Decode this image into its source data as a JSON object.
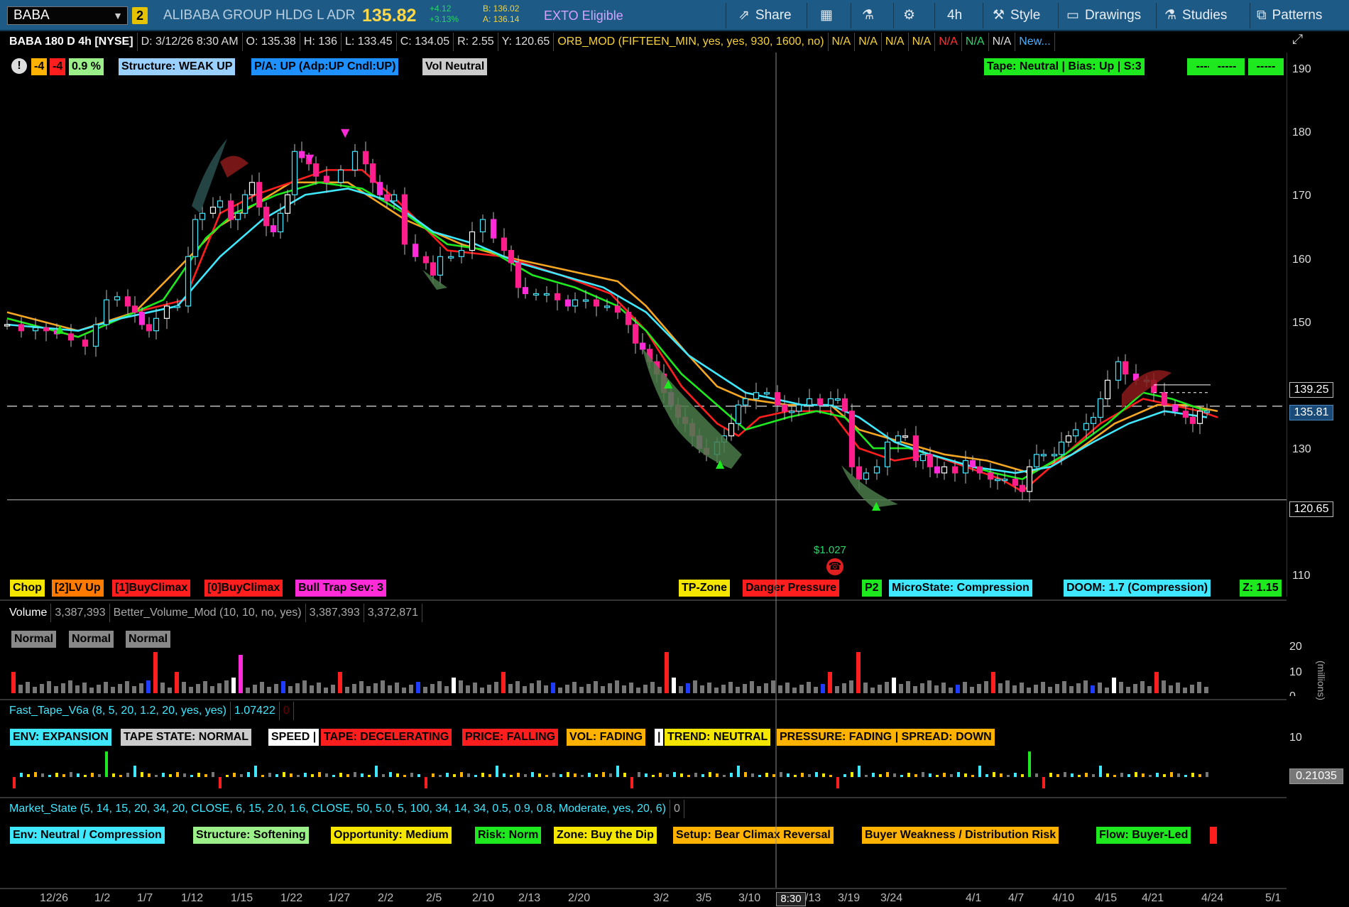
{
  "toolbar": {
    "symbol": "BABA",
    "link_badge": "2",
    "company": "ALIBABA GROUP HLDG L ADR",
    "last_price": "135.82",
    "change": "+4.12",
    "change_pct": "+3.13%",
    "bid": "B: 136.02",
    "ask": "A: 136.14",
    "exto": "EXTO Eligible",
    "share": "Share",
    "timeframe": "4h",
    "style": "Style",
    "drawings": "Drawings",
    "studies": "Studies",
    "patterns": "Patterns"
  },
  "header": {
    "title": "BABA 180 D 4h [NYSE]",
    "date": "D: 3/12/26 8:30 AM",
    "open": "O: 135.38",
    "high": "H: 136",
    "low": "L: 133.45",
    "close": "C: 134.05",
    "range": "R: 2.55",
    "y": "Y: 120.65",
    "study": "ORB_MOD (FIFTEEN_MIN, yes, yes, 930, 1600, no)",
    "na": [
      "N/A",
      "N/A",
      "N/A",
      "N/A",
      "N/A",
      "N/A",
      "N/A"
    ],
    "new": "New..."
  },
  "top_labels": {
    "alert": "!",
    "a": "-4",
    "b": "-4",
    "c": "0.9 %",
    "structure": "Structure: WEAK UP",
    "pa": "P/A: UP  (Adp:UP  Cndl:UP)",
    "vol": "Vol Neutral",
    "tape": "Tape: Neutral | Bias: Up | S:3",
    "d1": "-----",
    "d2": "-----",
    "d3": "-----"
  },
  "bottom_labels": {
    "chop": "Chop",
    "lv": "[2]LV Up",
    "bc1": "[1]BuyClimax",
    "bc0": "[0]BuyClimax",
    "trap": "Bull Trap  Sev: 3",
    "tp": "TP-Zone",
    "danger": "Danger Pressure",
    "p2": "P2",
    "micro": "MicroState: Compression",
    "doom": "DOOM: 1.7 (Compression)",
    "z": "Z: 1.15"
  },
  "annotation": "$1.027",
  "price_boxes": {
    "high_line": "139.25",
    "last": "135.81",
    "low_line": "120.65"
  },
  "volume_pane": {
    "label": "Volume",
    "value": "3,387,393",
    "study": "Better_Volume_Mod (10, 10, no, yes)",
    "v1": "3,387,393",
    "v2": "3,372,871",
    "tags": [
      "Normal",
      "Normal",
      "Normal"
    ],
    "axis": [
      "20",
      "10",
      "0"
    ],
    "unit": "(millions)"
  },
  "tape_pane": {
    "label": "Fast_Tape_V6a (8, 5, 20, 1.2, 20, yes, yes)",
    "value": "1.07422",
    "value2": "0",
    "env": "ENV: EXPANSION",
    "state": "TAPE STATE: NORMAL",
    "speed": "SPEED |",
    "tape": "TAPE: DECELERATING",
    "price": "PRICE: FALLING",
    "vol": "VOL: FADING",
    "bar": "|",
    "trend": "TREND: NEUTRAL",
    "pressure": "PRESSURE: FADING | SPREAD: DOWN",
    "axis": "10",
    "readout": "0.21035"
  },
  "market_pane": {
    "label": "Market_State (5, 14, 15, 20, 34, 20, CLOSE, 6, 15, 2.0, 1.6, CLOSE, 50, 5.0, 5, 100, 34, 14, 34, 0.5, 0.9, 0.8, Moderate, yes, 20, 6)",
    "value": "0",
    "env": "Env: Neutral / Compression",
    "structure": "Structure: Softening",
    "opp": "Opportunity: Medium",
    "risk": "Risk: Norm",
    "zone": "Zone: Buy the Dip",
    "setup": "Setup: Bear Climax Reversal",
    "buyer": "Buyer Weakness / Distribution Risk",
    "flow": "Flow: Buyer-Led"
  },
  "cursor_label": "8:30",
  "chart_data": {
    "type": "candlestick",
    "x_ticks": [
      "12/26",
      "1/2",
      "1/7",
      "1/12",
      "1/15",
      "1/22",
      "1/27",
      "2/2",
      "2/5",
      "2/10",
      "2/13",
      "2/20",
      "3/2",
      "3/5",
      "3/10",
      "3/13",
      "3/19",
      "3/24",
      "4/1",
      "4/7",
      "4/10",
      "4/15",
      "4/21",
      "4/24",
      "5/1"
    ],
    "y_ticks": [
      190,
      180,
      170,
      160,
      150,
      130,
      110
    ],
    "ylim": [
      105,
      193
    ],
    "price_path": [
      [
        0,
        149
      ],
      [
        20,
        148
      ],
      [
        40,
        148.5
      ],
      [
        55,
        148
      ],
      [
        70,
        147.5
      ],
      [
        90,
        146.5
      ],
      [
        110,
        145.5
      ],
      [
        125,
        149
      ],
      [
        140,
        153
      ],
      [
        155,
        153.5
      ],
      [
        170,
        152
      ],
      [
        180,
        151
      ],
      [
        190,
        149
      ],
      [
        200,
        148
      ],
      [
        210,
        150
      ],
      [
        225,
        152
      ],
      [
        240,
        152
      ],
      [
        255,
        160
      ],
      [
        265,
        166
      ],
      [
        275,
        167
      ],
      [
        290,
        168
      ],
      [
        300,
        169
      ],
      [
        315,
        166
      ],
      [
        325,
        167
      ],
      [
        335,
        170
      ],
      [
        345,
        172
      ],
      [
        355,
        168
      ],
      [
        365,
        165
      ],
      [
        375,
        164
      ],
      [
        385,
        167
      ],
      [
        395,
        170
      ],
      [
        405,
        177
      ],
      [
        415,
        176
      ],
      [
        425,
        175
      ],
      [
        435,
        173
      ],
      [
        450,
        172
      ],
      [
        470,
        174
      ],
      [
        490,
        177
      ],
      [
        505,
        175
      ],
      [
        515,
        172
      ],
      [
        525,
        170
      ],
      [
        535,
        169
      ],
      [
        545,
        170
      ],
      [
        560,
        162
      ],
      [
        575,
        160
      ],
      [
        590,
        159
      ],
      [
        600,
        157
      ],
      [
        610,
        160
      ],
      [
        625,
        160
      ],
      [
        640,
        161
      ],
      [
        655,
        164
      ],
      [
        670,
        166
      ],
      [
        685,
        163
      ],
      [
        700,
        161
      ],
      [
        710,
        159
      ],
      [
        720,
        155
      ],
      [
        730,
        154
      ],
      [
        745,
        154
      ],
      [
        760,
        154
      ],
      [
        775,
        153
      ],
      [
        790,
        152
      ],
      [
        800,
        153
      ],
      [
        815,
        153
      ],
      [
        830,
        152
      ],
      [
        845,
        152
      ],
      [
        860,
        151
      ],
      [
        875,
        149
      ],
      [
        885,
        146
      ],
      [
        895,
        145
      ],
      [
        905,
        143
      ],
      [
        915,
        141
      ],
      [
        925,
        138
      ],
      [
        935,
        136
      ],
      [
        945,
        134
      ],
      [
        955,
        133
      ],
      [
        965,
        131
      ],
      [
        975,
        129
      ],
      [
        985,
        128
      ],
      [
        1000,
        130
      ],
      [
        1010,
        131
      ],
      [
        1020,
        133
      ],
      [
        1030,
        136
      ],
      [
        1040,
        137
      ],
      [
        1055,
        138
      ],
      [
        1070,
        138
      ],
      [
        1085,
        136
      ],
      [
        1095,
        135
      ],
      [
        1105,
        135
      ],
      [
        1115,
        136
      ],
      [
        1130,
        137
      ],
      [
        1145,
        136
      ],
      [
        1160,
        137
      ],
      [
        1170,
        137
      ],
      [
        1180,
        135
      ],
      [
        1190,
        126
      ],
      [
        1200,
        124
      ],
      [
        1210,
        125
      ],
      [
        1225,
        126
      ],
      [
        1240,
        130
      ],
      [
        1255,
        131
      ],
      [
        1265,
        131
      ],
      [
        1280,
        127
      ],
      [
        1290,
        128
      ],
      [
        1300,
        126
      ],
      [
        1310,
        125
      ],
      [
        1320,
        126
      ],
      [
        1335,
        125
      ],
      [
        1350,
        127
      ],
      [
        1360,
        126
      ],
      [
        1370,
        125
      ],
      [
        1385,
        124
      ],
      [
        1395,
        124
      ],
      [
        1405,
        124
      ],
      [
        1420,
        123
      ],
      [
        1430,
        122
      ],
      [
        1440,
        126
      ],
      [
        1450,
        128
      ],
      [
        1460,
        128
      ],
      [
        1475,
        128
      ],
      [
        1485,
        130
      ],
      [
        1495,
        131
      ],
      [
        1505,
        132
      ],
      [
        1520,
        133
      ],
      [
        1530,
        134
      ],
      [
        1540,
        137
      ],
      [
        1550,
        140
      ],
      [
        1565,
        143
      ],
      [
        1575,
        141
      ],
      [
        1590,
        140
      ],
      [
        1605,
        140
      ],
      [
        1615,
        138
      ],
      [
        1630,
        136
      ],
      [
        1645,
        135
      ],
      [
        1660,
        134
      ],
      [
        1670,
        133
      ],
      [
        1680,
        135
      ],
      [
        1690,
        135
      ]
    ],
    "ema_red": [
      [
        0,
        150
      ],
      [
        100,
        147
      ],
      [
        180,
        151
      ],
      [
        250,
        153
      ],
      [
        300,
        167
      ],
      [
        350,
        170
      ],
      [
        400,
        172
      ],
      [
        450,
        174
      ],
      [
        500,
        174
      ],
      [
        550,
        169
      ],
      [
        620,
        161
      ],
      [
        700,
        160
      ],
      [
        780,
        157
      ],
      [
        850,
        154
      ],
      [
        900,
        148
      ],
      [
        950,
        139
      ],
      [
        1000,
        133
      ],
      [
        1030,
        131
      ],
      [
        1060,
        134
      ],
      [
        1100,
        135
      ],
      [
        1160,
        135
      ],
      [
        1200,
        129
      ],
      [
        1250,
        127
      ],
      [
        1300,
        128
      ],
      [
        1350,
        126
      ],
      [
        1400,
        124
      ],
      [
        1430,
        122
      ],
      [
        1480,
        127
      ],
      [
        1540,
        133
      ],
      [
        1600,
        137
      ],
      [
        1640,
        136
      ],
      [
        1680,
        135
      ],
      [
        1705,
        134
      ]
    ],
    "ema_yellow": [
      [
        0,
        151
      ],
      [
        100,
        148
      ],
      [
        180,
        151
      ],
      [
        300,
        165
      ],
      [
        400,
        172
      ],
      [
        480,
        172
      ],
      [
        560,
        166
      ],
      [
        640,
        162
      ],
      [
        700,
        160
      ],
      [
        780,
        158
      ],
      [
        860,
        156
      ],
      [
        900,
        152
      ],
      [
        960,
        144
      ],
      [
        1000,
        139
      ],
      [
        1040,
        137
      ],
      [
        1100,
        136
      ],
      [
        1160,
        136
      ],
      [
        1200,
        132
      ],
      [
        1260,
        130
      ],
      [
        1320,
        128
      ],
      [
        1380,
        127
      ],
      [
        1440,
        125
      ],
      [
        1500,
        128
      ],
      [
        1560,
        133
      ],
      [
        1620,
        136
      ],
      [
        1660,
        136
      ],
      [
        1705,
        135
      ]
    ],
    "ema_green": [
      [
        0,
        150
      ],
      [
        100,
        147
      ],
      [
        160,
        150
      ],
      [
        220,
        153
      ],
      [
        280,
        163
      ],
      [
        320,
        167
      ],
      [
        380,
        170
      ],
      [
        440,
        172
      ],
      [
        500,
        171
      ],
      [
        560,
        167
      ],
      [
        620,
        162
      ],
      [
        680,
        161
      ],
      [
        740,
        157
      ],
      [
        800,
        155
      ],
      [
        860,
        152
      ],
      [
        900,
        148
      ],
      [
        950,
        141
      ],
      [
        1000,
        136
      ],
      [
        1040,
        132
      ],
      [
        1100,
        134
      ],
      [
        1140,
        135
      ],
      [
        1180,
        134
      ],
      [
        1220,
        129
      ],
      [
        1270,
        129
      ],
      [
        1330,
        127
      ],
      [
        1390,
        125
      ],
      [
        1430,
        124
      ],
      [
        1490,
        128
      ],
      [
        1550,
        133
      ],
      [
        1600,
        138
      ],
      [
        1640,
        137
      ],
      [
        1690,
        135
      ]
    ],
    "ema_cyan": [
      [
        0,
        149
      ],
      [
        100,
        148
      ],
      [
        160,
        150
      ],
      [
        240,
        152
      ],
      [
        300,
        160
      ],
      [
        360,
        166
      ],
      [
        420,
        170
      ],
      [
        480,
        171
      ],
      [
        540,
        169
      ],
      [
        600,
        164
      ],
      [
        660,
        162
      ],
      [
        720,
        159
      ],
      [
        780,
        157
      ],
      [
        840,
        155
      ],
      [
        900,
        151
      ],
      [
        960,
        144
      ],
      [
        1000,
        141
      ],
      [
        1040,
        138
      ],
      [
        1080,
        137
      ],
      [
        1120,
        136
      ],
      [
        1160,
        136
      ],
      [
        1200,
        134
      ],
      [
        1250,
        130
      ],
      [
        1300,
        128
      ],
      [
        1360,
        126
      ],
      [
        1420,
        125
      ],
      [
        1470,
        126
      ],
      [
        1530,
        130
      ],
      [
        1580,
        133
      ],
      [
        1630,
        135
      ],
      [
        1690,
        134
      ]
    ],
    "horizontal_levels": [
      135.81,
      120.65
    ]
  }
}
